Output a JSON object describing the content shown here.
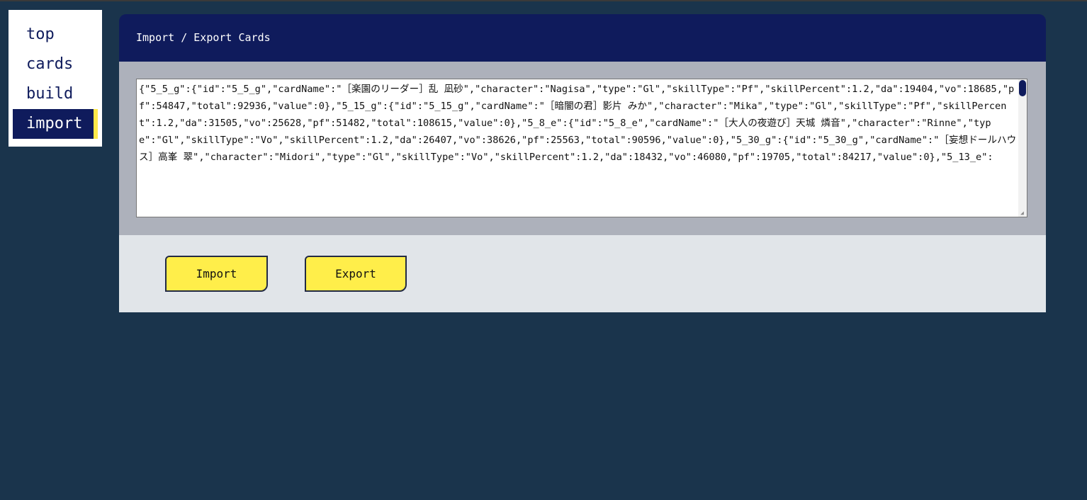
{
  "nav": {
    "items": [
      {
        "label": "top"
      },
      {
        "label": "cards"
      },
      {
        "label": "build"
      },
      {
        "label": "import"
      }
    ],
    "active": "import"
  },
  "panel": {
    "title": "Import / Export Cards",
    "data_text": "{\"5_5_g\":{\"id\":\"5_5_g\",\"cardName\":\"［楽園のリーダー］乱 凪砂\",\"character\":\"Nagisa\",\"type\":\"Gl\",\"skillType\":\"Pf\",\"skillPercent\":1.2,\"da\":19404,\"vo\":18685,\"pf\":54847,\"total\":92936,\"value\":0},\"5_15_g\":{\"id\":\"5_15_g\",\"cardName\":\"［暗闇の君］影片 みか\",\"character\":\"Mika\",\"type\":\"Gl\",\"skillType\":\"Pf\",\"skillPercent\":1.2,\"da\":31505,\"vo\":25628,\"pf\":51482,\"total\":108615,\"value\":0},\"5_8_e\":{\"id\":\"5_8_e\",\"cardName\":\"［大人の夜遊び］天城 燐音\",\"character\":\"Rinne\",\"type\":\"Gl\",\"skillType\":\"Vo\",\"skillPercent\":1.2,\"da\":26407,\"vo\":38626,\"pf\":25563,\"total\":90596,\"value\":0},\"5_30_g\":{\"id\":\"5_30_g\",\"cardName\":\"［妄想ドールハウス］高峯 翠\",\"character\":\"Midori\",\"type\":\"Gl\",\"skillType\":\"Vo\",\"skillPercent\":1.2,\"da\":18432,\"vo\":46080,\"pf\":19705,\"total\":84217,\"value\":0},\"5_13_e\":"
  },
  "buttons": {
    "import_label": "Import",
    "export_label": "Export"
  },
  "colors": {
    "background": "#1a344c",
    "header": "#0f1b5c",
    "accent": "#ffee4a",
    "panel_body": "#adb1bb",
    "panel_footer": "#e1e5e9"
  }
}
